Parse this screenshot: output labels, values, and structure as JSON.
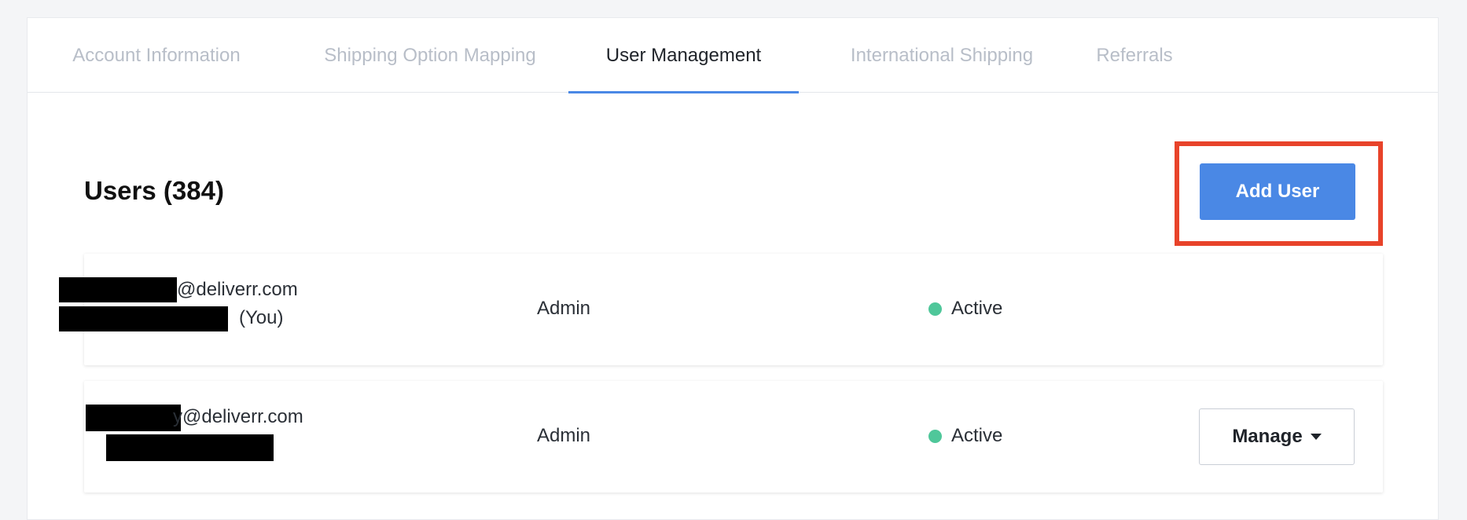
{
  "tabs": [
    {
      "label": "Account Information",
      "active": false
    },
    {
      "label": "Shipping Option Mapping",
      "active": false
    },
    {
      "label": "User Management",
      "active": true
    },
    {
      "label": "International Shipping",
      "active": false
    },
    {
      "label": "Referrals",
      "active": false
    }
  ],
  "header": {
    "title": "Users (384)",
    "add_user_label": "Add User"
  },
  "users": [
    {
      "email_suffix": "@deliverr.com",
      "you_label": "(You)",
      "role": "Admin",
      "status": "Active"
    },
    {
      "email_suffix": "y@deliverr.com",
      "role": "Admin",
      "status": "Active",
      "manage_label": "Manage"
    }
  ],
  "colors": {
    "accent": "#4a88e5",
    "highlight": "#e8432a",
    "status_active": "#4fc79a"
  },
  "icons": {
    "manage_caret": "chevron-down-icon",
    "status_indicator": "status-dot-icon"
  }
}
